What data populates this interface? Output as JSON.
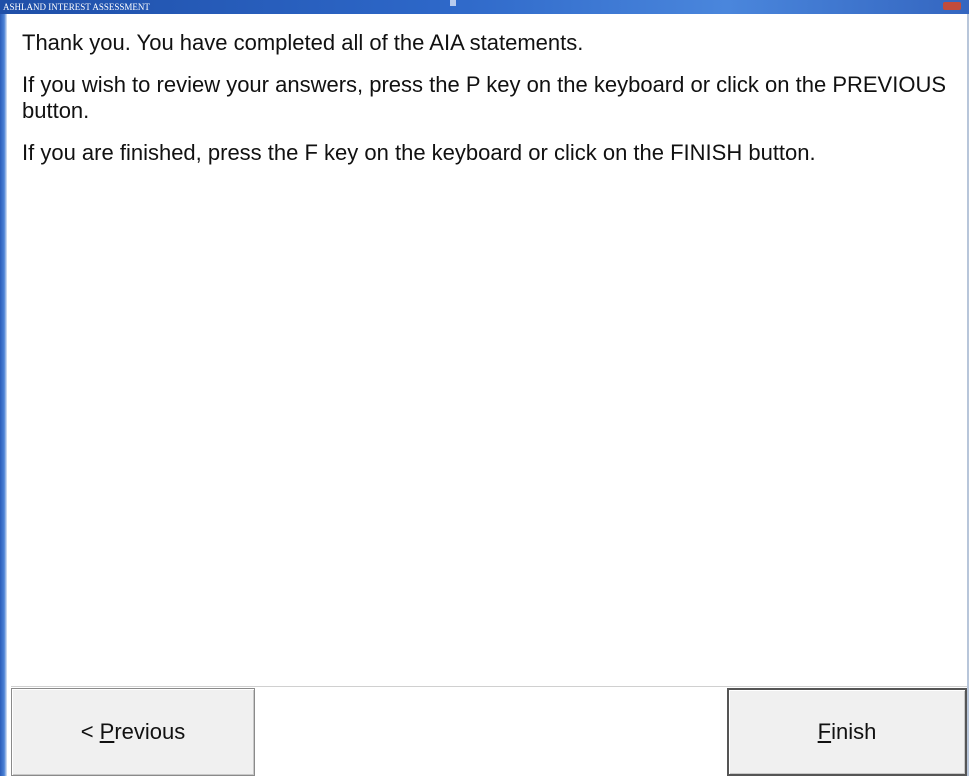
{
  "window": {
    "title": "ASHLAND INTEREST ASSESSMENT"
  },
  "messages": [
    "Thank you. You have completed all of the AIA statements.",
    "If you wish to review your answers, press the P key on the keyboard or click on the PREVIOUS button.",
    "If you are finished, press the F key on the keyboard or click on the FINISH button."
  ],
  "buttons": {
    "previous": {
      "prefix": "< ",
      "mnemonic": "P",
      "rest": "revious"
    },
    "finish": {
      "mnemonic": "F",
      "rest": "inish"
    }
  },
  "colors": {
    "titlebar": "#2d67c8",
    "close_button": "#c24c3c",
    "button_face": "#f0f0f0"
  }
}
